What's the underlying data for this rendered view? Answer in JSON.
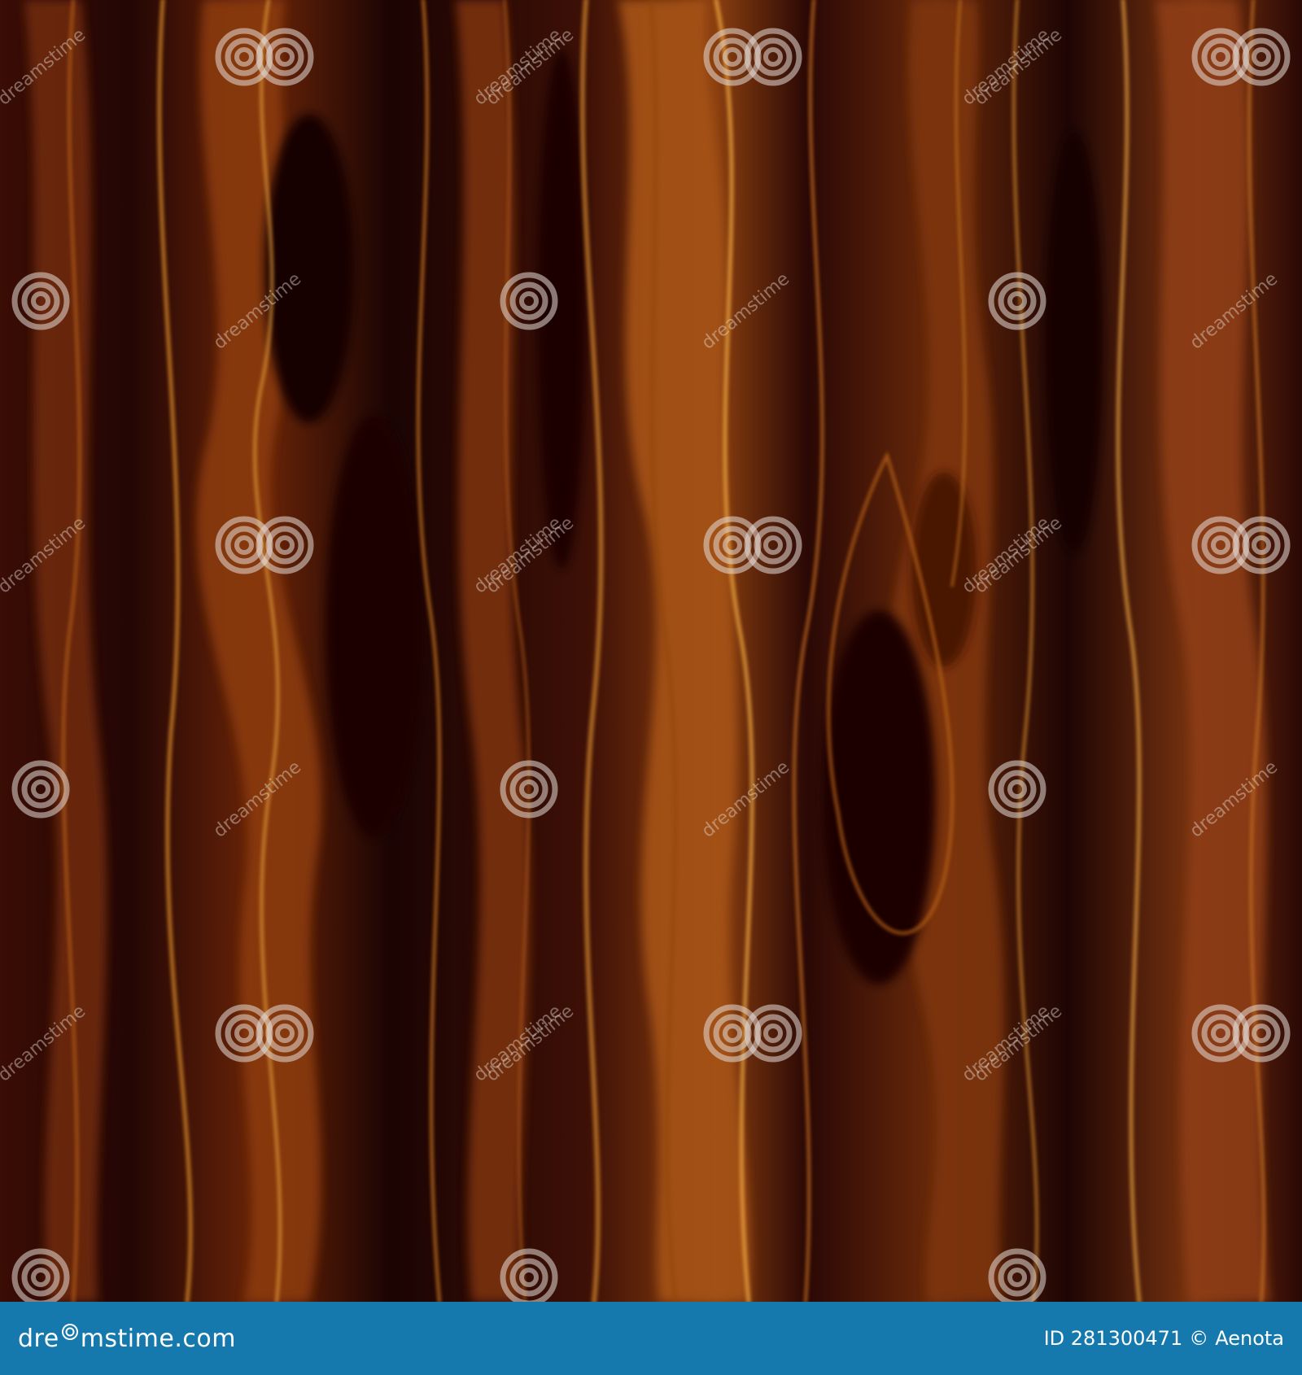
{
  "image": {
    "subject": "wood-grain-texture",
    "colors": {
      "dark": "#1b0403",
      "mid": "#5a1c08",
      "warm": "#9a4a12",
      "highlight": "#d88a2a",
      "footer": "#1679ad"
    }
  },
  "watermark": {
    "text": "dreamstime",
    "icon": "spiral-icon"
  },
  "footer": {
    "brand": "dreamstime.com",
    "brand_parts": [
      "dre",
      "mstime.com"
    ],
    "id_label": "ID 281300471",
    "copyright_symbol": "©",
    "author": "Aenota"
  }
}
